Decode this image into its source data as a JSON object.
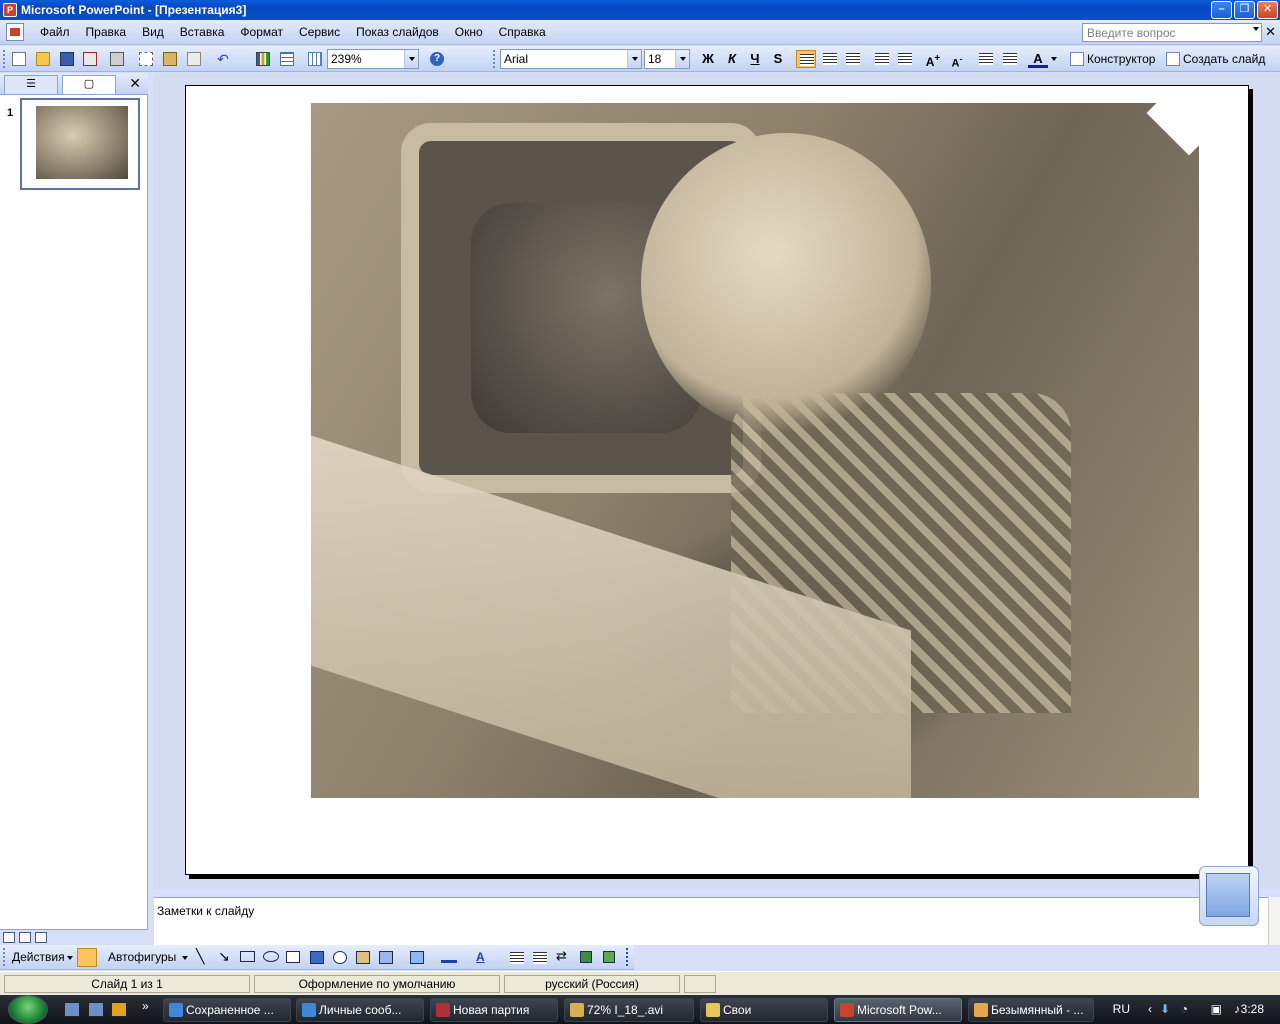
{
  "window": {
    "title": "Microsoft PowerPoint - [Презентация3]"
  },
  "menu": {
    "items": [
      "Файл",
      "Правка",
      "Вид",
      "Вставка",
      "Формат",
      "Сервис",
      "Показ слайдов",
      "Окно",
      "Справка"
    ],
    "ask_placeholder": "Введите вопрос"
  },
  "toolbar": {
    "zoom": "239%",
    "font": "Arial",
    "font_size": "18",
    "bold": "Ж",
    "italic": "К",
    "underline": "Ч",
    "shadow": "S",
    "designer": "Конструктор",
    "new_slide": "Создать слайд"
  },
  "slides_panel": {
    "slide_number": "1"
  },
  "notes": {
    "placeholder": "Заметки к слайду"
  },
  "draw_toolbar": {
    "actions": "Действия",
    "autoshapes": "Автофигуры"
  },
  "status": {
    "slide": "Слайд 1 из 1",
    "design": "Оформление по умолчанию",
    "language": "русский (Россия)"
  },
  "taskbar": {
    "tasks": [
      "Сохраненное ...",
      "Личные сооб...",
      "Новая партия",
      "72% I_18_.avi",
      "Свои",
      "Microsoft Pow...",
      "Безымянный - ..."
    ],
    "lang": "RU",
    "time": "3:28"
  },
  "colors": {
    "titlebar": "#0a5cd8",
    "toolbar": "#c4d3f3",
    "active_button": "#ffc35c"
  }
}
